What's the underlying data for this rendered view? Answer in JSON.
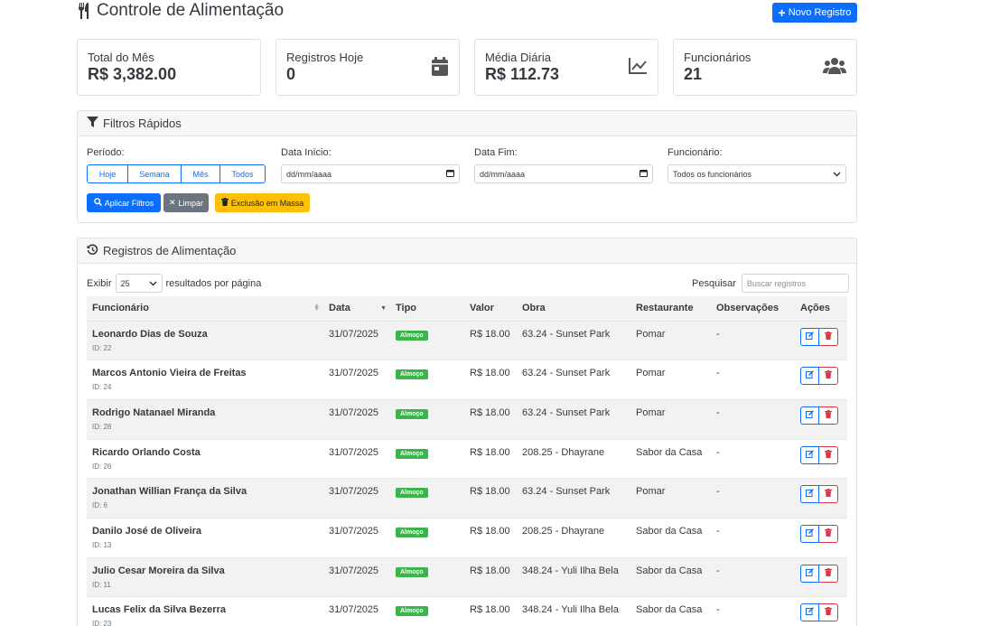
{
  "header": {
    "title": "Controle de Alimentação",
    "new_button": "Novo Registro"
  },
  "stats": [
    {
      "label": "Total do Mês",
      "value": "R$ 3,382.00",
      "icon": ""
    },
    {
      "label": "Registros Hoje",
      "value": "0",
      "icon": "calendar-icon"
    },
    {
      "label": "Média Diária",
      "value": "R$ 112.73",
      "icon": "line-chart-icon"
    },
    {
      "label": "Funcionários",
      "value": "21",
      "icon": "users-icon"
    }
  ],
  "filters": {
    "title": "Filtros Rápidos",
    "period_label": "Período:",
    "period_options": [
      "Hoje",
      "Semana",
      "Mês",
      "Todos"
    ],
    "start_label": "Data Início:",
    "start_placeholder": "dd/mm/aaaa",
    "end_label": "Data Fim:",
    "end_placeholder": "dd/mm/aaaa",
    "employee_label": "Funcionário:",
    "employee_selected": "Todos os funcionários",
    "apply_button": "Aplicar Filtros",
    "clear_button": "Limpar",
    "bulk_delete_button": "Exclusão em Massa"
  },
  "records": {
    "title": "Registros de Alimentação",
    "show_prefix": "Exibir",
    "page_size": "25",
    "show_suffix": "resultados por página",
    "search_label": "Pesquisar",
    "search_placeholder": "Buscar registros",
    "columns": [
      "Funcionário",
      "Data",
      "Tipo",
      "Valor",
      "Obra",
      "Restaurante",
      "Observações",
      "Ações"
    ],
    "rows": [
      {
        "name": "Leonardo Dias de Souza",
        "id": "ID: 22",
        "date": "31/07/2025",
        "type": "Almoço",
        "value": "R$ 18.00",
        "site": "63.24 - Sunset Park",
        "restaurant": "Pomar",
        "notes": "-"
      },
      {
        "name": "Marcos Antonio Vieira de Freitas",
        "id": "ID: 24",
        "date": "31/07/2025",
        "type": "Almoço",
        "value": "R$ 18.00",
        "site": "63.24 - Sunset Park",
        "restaurant": "Pomar",
        "notes": "-"
      },
      {
        "name": "Rodrigo Natanael Miranda",
        "id": "ID: 28",
        "date": "31/07/2025",
        "type": "Almoço",
        "value": "R$ 18.00",
        "site": "63.24 - Sunset Park",
        "restaurant": "Pomar",
        "notes": "-"
      },
      {
        "name": "Ricardo Orlando Costa",
        "id": "ID: 26",
        "date": "31/07/2025",
        "type": "Almoço",
        "value": "R$ 18.00",
        "site": "208.25 - Dhayrane",
        "restaurant": "Sabor da Casa",
        "notes": "-"
      },
      {
        "name": "Jonathan Willian França da Silva",
        "id": "ID: 6",
        "date": "31/07/2025",
        "type": "Almoço",
        "value": "R$ 18.00",
        "site": "63.24 - Sunset Park",
        "restaurant": "Pomar",
        "notes": "-"
      },
      {
        "name": "Danilo José de Oliveira",
        "id": "ID: 13",
        "date": "31/07/2025",
        "type": "Almoço",
        "value": "R$ 18.00",
        "site": "208.25 - Dhayrane",
        "restaurant": "Sabor da Casa",
        "notes": "-"
      },
      {
        "name": "Julio Cesar Moreira da Silva",
        "id": "ID: 11",
        "date": "31/07/2025",
        "type": "Almoço",
        "value": "R$ 18.00",
        "site": "348.24 - Yuli Ilha Bela",
        "restaurant": "Sabor da Casa",
        "notes": "-"
      },
      {
        "name": "Lucas Felix da Silva Bezerra",
        "id": "ID: 23",
        "date": "31/07/2025",
        "type": "Almoço",
        "value": "R$ 18.00",
        "site": "348.24 - Yuli Ilha Bela",
        "restaurant": "Sabor da Casa",
        "notes": "-"
      }
    ]
  },
  "colors": {
    "primary": "#0d6efd",
    "warning": "#ffc107",
    "danger": "#dc3545",
    "success_badge": "#3ab54a",
    "secondary": "#6c757d"
  }
}
